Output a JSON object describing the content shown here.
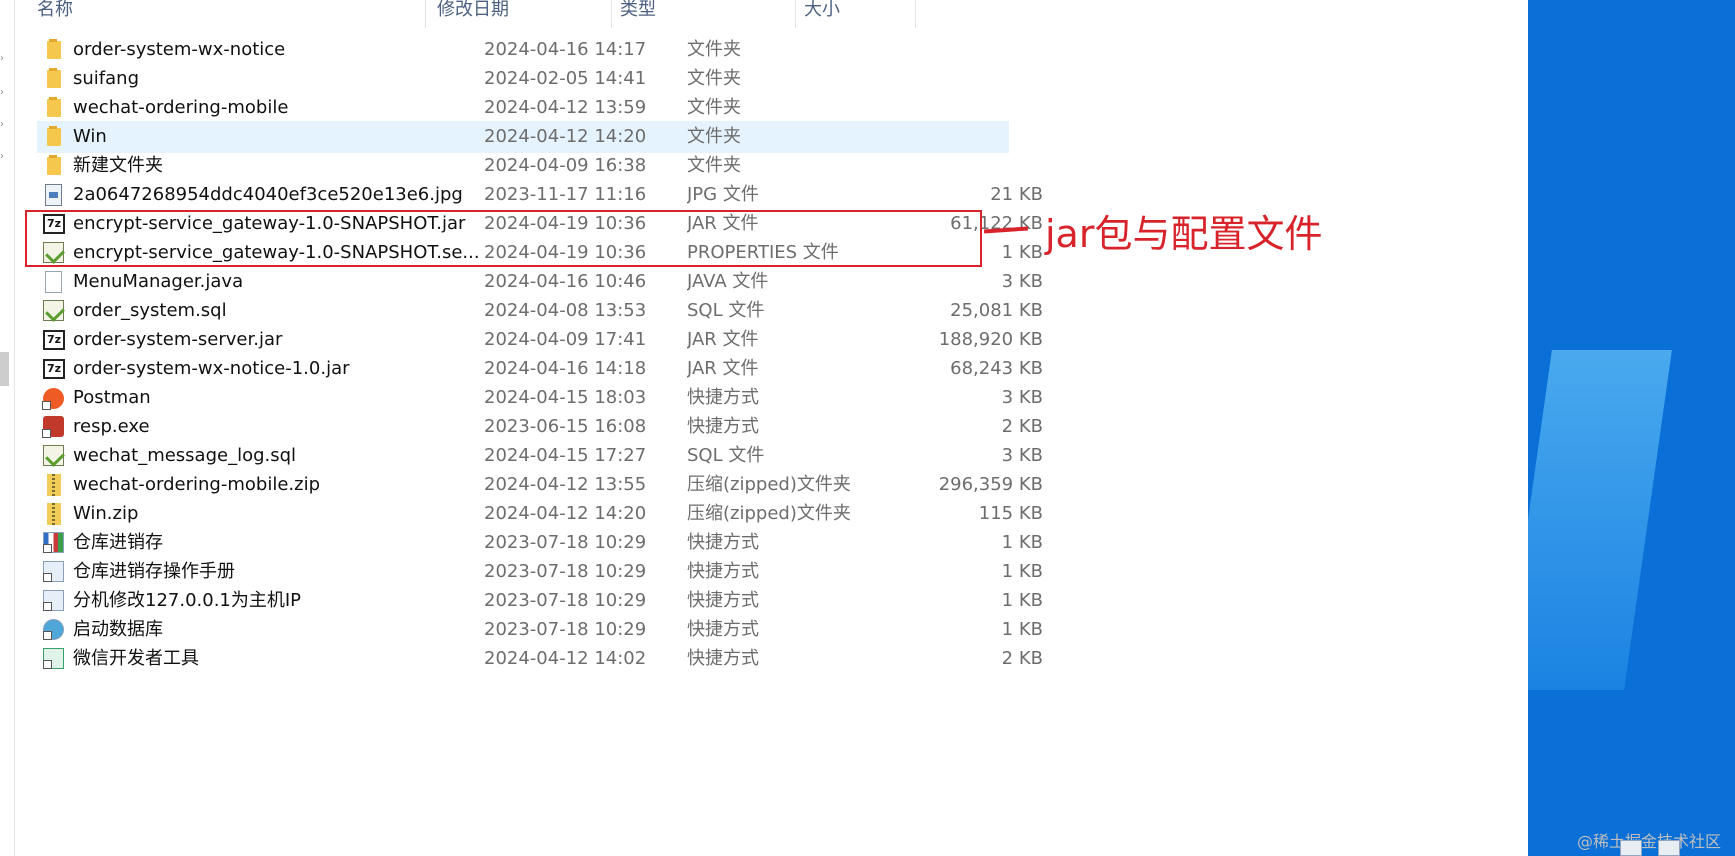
{
  "columns": {
    "name": "名称",
    "date": "修改日期",
    "type": "类型",
    "size": "大小"
  },
  "files": [
    {
      "name": "order-system-wx-notice",
      "date": "2024-04-16 14:17",
      "type": "文件夹",
      "size": "",
      "icon": "folder-icon"
    },
    {
      "name": "suifang",
      "date": "2024-02-05 14:41",
      "type": "文件夹",
      "size": "",
      "icon": "folder-icon"
    },
    {
      "name": "wechat-ordering-mobile",
      "date": "2024-04-12 13:59",
      "type": "文件夹",
      "size": "",
      "icon": "folder-icon"
    },
    {
      "name": "Win",
      "date": "2024-04-12 14:20",
      "type": "文件夹",
      "size": "",
      "icon": "folder-icon",
      "selected": true
    },
    {
      "name": "新建文件夹",
      "date": "2024-04-09 16:38",
      "type": "文件夹",
      "size": "",
      "icon": "folder-icon"
    },
    {
      "name": "2a0647268954ddc4040ef3ce520e13e6.jpg",
      "date": "2023-11-17 11:16",
      "type": "JPG 文件",
      "size": "21 KB",
      "icon": "image-file-icon"
    },
    {
      "name": "encrypt-service_gateway-1.0-SNAPSHOT.jar",
      "date": "2024-04-19 10:36",
      "type": "JAR 文件",
      "size": "61,122 KB",
      "icon": "7z-archive-icon"
    },
    {
      "name": "encrypt-service_gateway-1.0-SNAPSHOT.se...",
      "date": "2024-04-19 10:36",
      "type": "PROPERTIES 文件",
      "size": "1 KB",
      "icon": "notepad-file-icon"
    },
    {
      "name": "MenuManager.java",
      "date": "2024-04-16 10:46",
      "type": "JAVA 文件",
      "size": "3 KB",
      "icon": "blank-file-icon"
    },
    {
      "name": "order_system.sql",
      "date": "2024-04-08 13:53",
      "type": "SQL 文件",
      "size": "25,081 KB",
      "icon": "notepad-file-icon"
    },
    {
      "name": "order-system-server.jar",
      "date": "2024-04-09 17:41",
      "type": "JAR 文件",
      "size": "188,920 KB",
      "icon": "7z-archive-icon"
    },
    {
      "name": "order-system-wx-notice-1.0.jar",
      "date": "2024-04-16 14:18",
      "type": "JAR 文件",
      "size": "68,243 KB",
      "icon": "7z-archive-icon"
    },
    {
      "name": "Postman",
      "date": "2024-04-15 18:03",
      "type": "快捷方式",
      "size": "3 KB",
      "icon": "postman-icon"
    },
    {
      "name": "resp.exe",
      "date": "2023-06-15 16:08",
      "type": "快捷方式",
      "size": "2 KB",
      "icon": "exe-icon"
    },
    {
      "name": "wechat_message_log.sql",
      "date": "2024-04-15 17:27",
      "type": "SQL 文件",
      "size": "3 KB",
      "icon": "notepad-file-icon"
    },
    {
      "name": "wechat-ordering-mobile.zip",
      "date": "2024-04-12 13:55",
      "type": "压缩(zipped)文件夹",
      "size": "296,359 KB",
      "icon": "zip-folder-icon"
    },
    {
      "name": "Win.zip",
      "date": "2024-04-12 14:20",
      "type": "压缩(zipped)文件夹",
      "size": "115 KB",
      "icon": "zip-folder-icon"
    },
    {
      "name": "仓库进销存",
      "date": "2023-07-18 10:29",
      "type": "快捷方式",
      "size": "1 KB",
      "icon": "app-shortcut-icon"
    },
    {
      "name": "仓库进销存操作手册",
      "date": "2023-07-18 10:29",
      "type": "快捷方式",
      "size": "1 KB",
      "icon": "document-shortcut-icon"
    },
    {
      "name": "分机修改127.0.0.1为主机IP",
      "date": "2023-07-18 10:29",
      "type": "快捷方式",
      "size": "1 KB",
      "icon": "notepad-shortcut-icon"
    },
    {
      "name": "启动数据库",
      "date": "2023-07-18 10:29",
      "type": "快捷方式",
      "size": "1 KB",
      "icon": "database-shortcut-icon"
    },
    {
      "name": "微信开发者工具",
      "date": "2024-04-12 14:02",
      "type": "快捷方式",
      "size": "2 KB",
      "icon": "wechat-devtools-shortcut-icon"
    }
  ],
  "annotation": {
    "text": "jar包与配置文件",
    "color": "#d8232a"
  },
  "watermark": "@稀土掘金技术社区",
  "jar_badge": "7z"
}
